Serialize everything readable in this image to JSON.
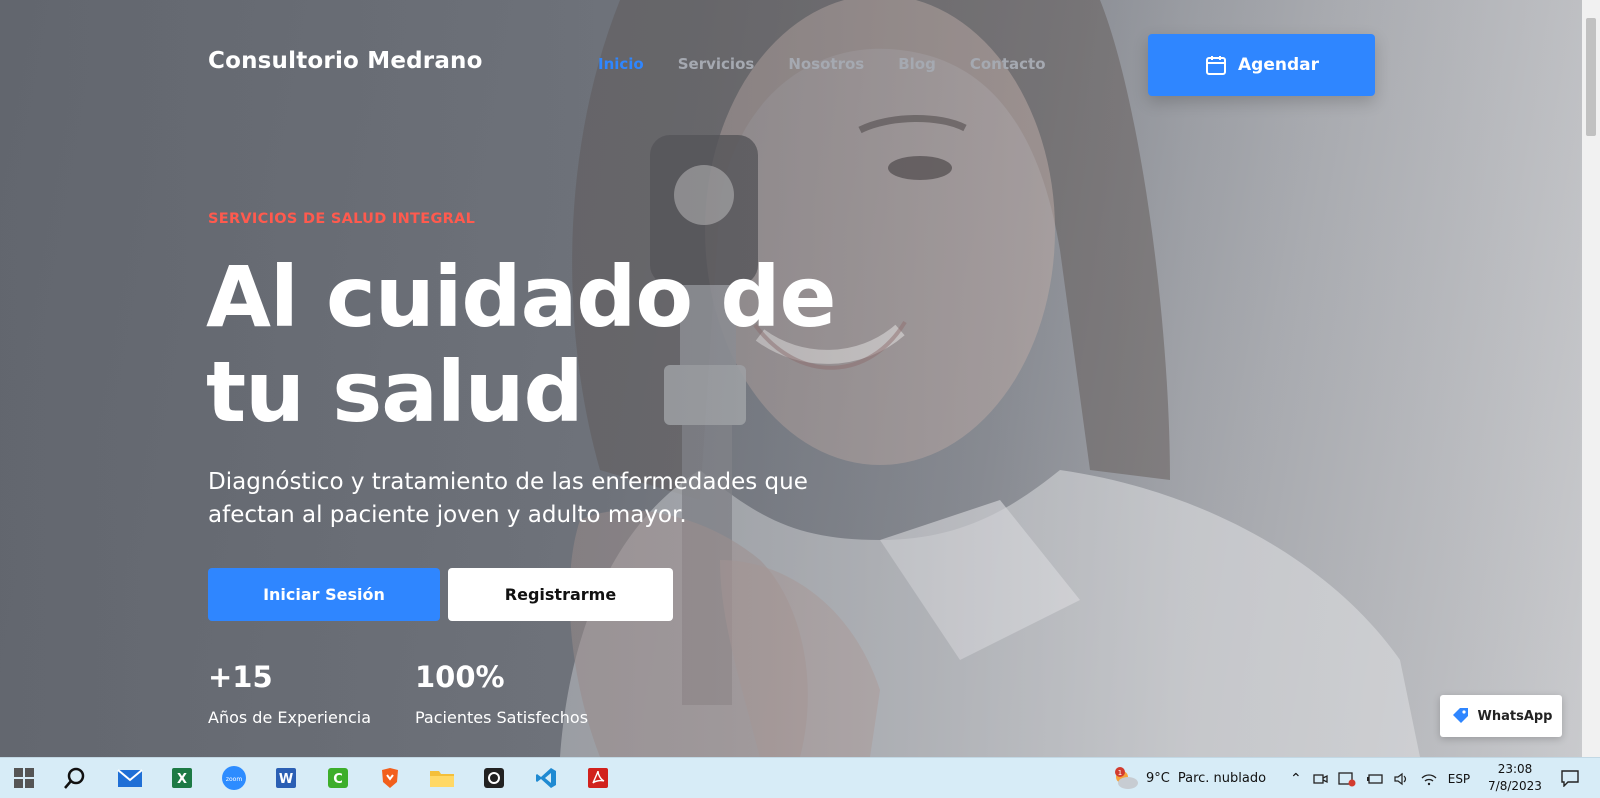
{
  "brand": "Consultorio Medrano",
  "nav": {
    "items": [
      "Inicio",
      "Servicios",
      "Nosotros",
      "Blog",
      "Contacto"
    ],
    "active": "Inicio",
    "cta": "Agendar"
  },
  "hero": {
    "eyebrow": "SERVICIOS DE SALUD INTEGRAL",
    "title_line1": "Al cuidado de",
    "title_line2": "tu salud",
    "subtitle_line1": "Diagnóstico y tratamiento de las enfermedades que",
    "subtitle_line2": "afectan al paciente joven y adulto mayor.",
    "primary_button": "Iniciar Sesión",
    "secondary_button": "Registrarme"
  },
  "stats": [
    {
      "value": "+15",
      "label": "Años de Experiencia"
    },
    {
      "value": "100%",
      "label": "Pacientes Satisfechos"
    }
  ],
  "whatsapp": {
    "label": "WhatsApp"
  },
  "colors": {
    "accent": "#2f86ff",
    "eyebrow": "#ff5a4e"
  },
  "taskbar": {
    "apps": [
      "windows-start",
      "search",
      "mail",
      "excel",
      "zoom",
      "word",
      "camtasia",
      "brave",
      "file-explorer",
      "github",
      "vscode",
      "acrobat"
    ],
    "zoom_label": "zoom",
    "weather": {
      "temp": "9°C",
      "desc": "Parc. nublado",
      "badge": "1"
    },
    "lang": "ESP",
    "time": "23:08",
    "date": "7/8/2023"
  }
}
